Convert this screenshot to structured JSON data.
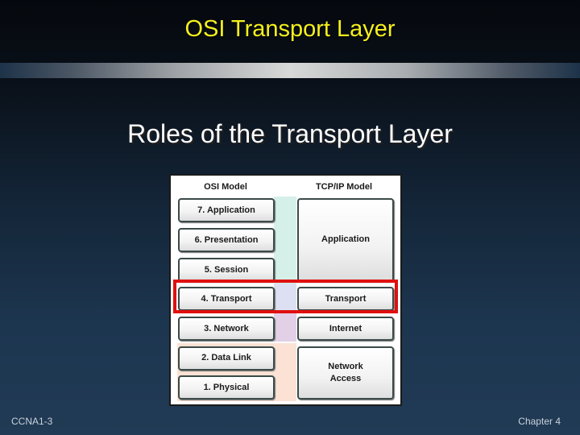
{
  "slide": {
    "title": "OSI Transport Layer",
    "subtitle": "Roles of the Transport Layer",
    "footer_left": "CCNA1-3",
    "footer_right": "Chapter 4"
  },
  "diagram": {
    "osi_header": "OSI Model",
    "tcpip_header": "TCP/IP Model",
    "osi_layers": [
      "7. Application",
      "6. Presentation",
      "5. Session",
      "4. Transport",
      "3. Network",
      "2. Data Link",
      "1. Physical"
    ],
    "tcpip_layers": [
      "Application",
      "Transport",
      "Internet",
      "Network Access"
    ],
    "highlighted_layer": "Transport",
    "colors": {
      "title": "#f4f01e",
      "highlight": "#e01010",
      "strip_application": "#d5f0e8",
      "strip_transport": "#dde0f2",
      "strip_internet": "#e2d0e6",
      "strip_network_access": "#fbe2d4"
    }
  }
}
